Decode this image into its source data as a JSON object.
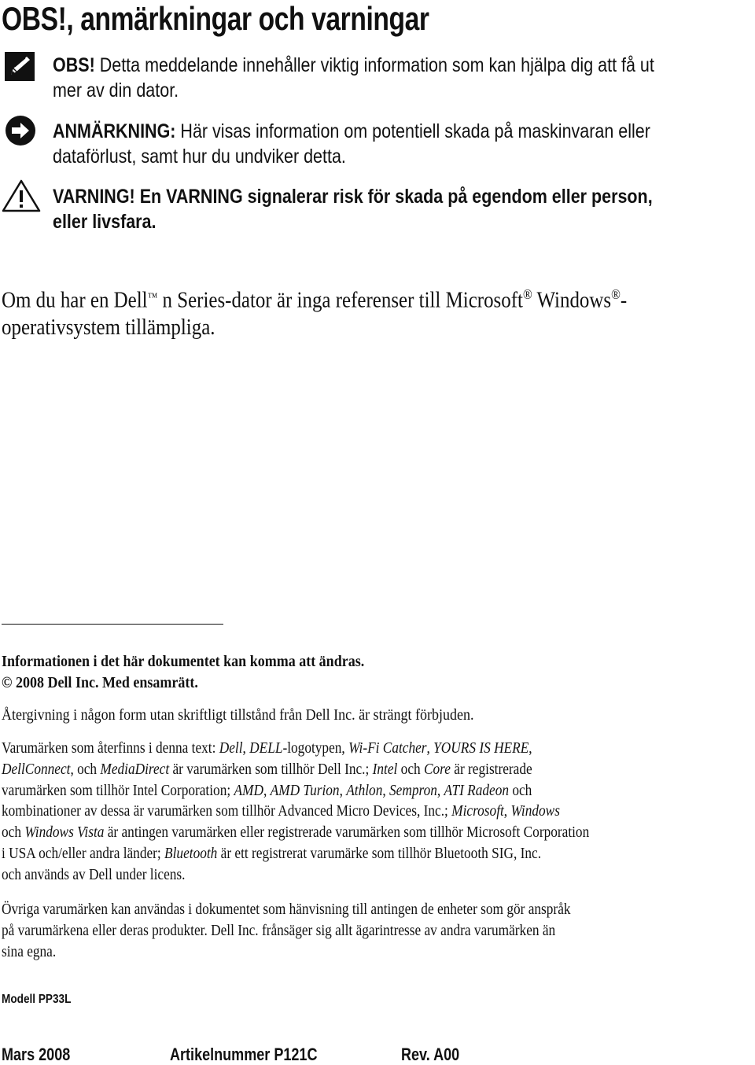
{
  "title": "OBS!, anmärkningar och varningar",
  "notes": [
    {
      "icon": "pencil-icon",
      "label": "OBS!",
      "line1": " Detta meddelande innehåller viktig information som kan hjälpa dig att få ut",
      "line2": "mer av din dator."
    },
    {
      "icon": "arrow-right-circle-icon",
      "label": "ANMÄRKNING:",
      "line1": " Här visas information om potentiell skada på maskinvaran eller",
      "line2": "dataförlust, samt hur du undviker detta."
    },
    {
      "icon": "warning-triangle-icon",
      "label": "VARNING!",
      "line1": " En VARNING signalerar risk för skada på egendom eller person,",
      "line2": "eller livsfara."
    }
  ],
  "series_note": {
    "part1": "Om du har en Dell",
    "tm": "™",
    "part2": " n Series-dator är inga referenser till Microsoft",
    "reg1": "®",
    "part3": " Windows",
    "reg2": "®",
    "part4": "-",
    "line2": "operativsystem tillämpliga."
  },
  "legal": {
    "change_notice": "Informationen i det här dokumentet kan komma att ändras.",
    "copyright": "© 2008 Dell Inc. Med ensamrätt.",
    "reproduction": "Återgivning i någon form utan skriftligt tillstånd från Dell Inc. är strängt förbjuden.",
    "trademarks_lines": [
      "Varumärken som återfinns i denna text: <i>Dell</i>, <i>DELL</i>-logotypen, <i>Wi-Fi Catcher</i>, <i>YOURS IS HERE</i>,",
      "<i>DellConnect</i>, och <i>MediaDirect</i> är varumärken som tillhör Dell Inc.; <i>Intel</i> och <i>Core</i> är registrerade",
      "varumärken som tillhör Intel Corporation; <i>AMD</i>, <i>AMD Turion</i>, <i>Athlon</i>, <i>Sempron</i>, <i>ATI Radeon</i> och",
      "kombinationer av dessa är varumärken som tillhör Advanced Micro Devices, Inc.; <i>Microsoft</i>, <i>Windows</i>",
      "och <i>Windows Vista</i> är antingen varumärken eller registrerade varumärken som tillhör Microsoft Corporation",
      "i USA och/eller andra länder; <i>Bluetooth</i> är ett registrerat varumärke som tillhör Bluetooth SIG, Inc.",
      "och används av Dell under licens."
    ],
    "other_lines": [
      "Övriga varumärken kan användas i dokumentet som hänvisning till antingen de enheter som gör anspråk",
      "på varumärkena eller deras produkter. Dell Inc. frånsäger sig allt ägarintresse av andra varumärken än",
      "sina egna."
    ]
  },
  "footer": {
    "model": "Modell PP33L",
    "date": "Mars 2008",
    "part_number": "Artikelnummer P121C",
    "revision": "Rev. A00"
  }
}
